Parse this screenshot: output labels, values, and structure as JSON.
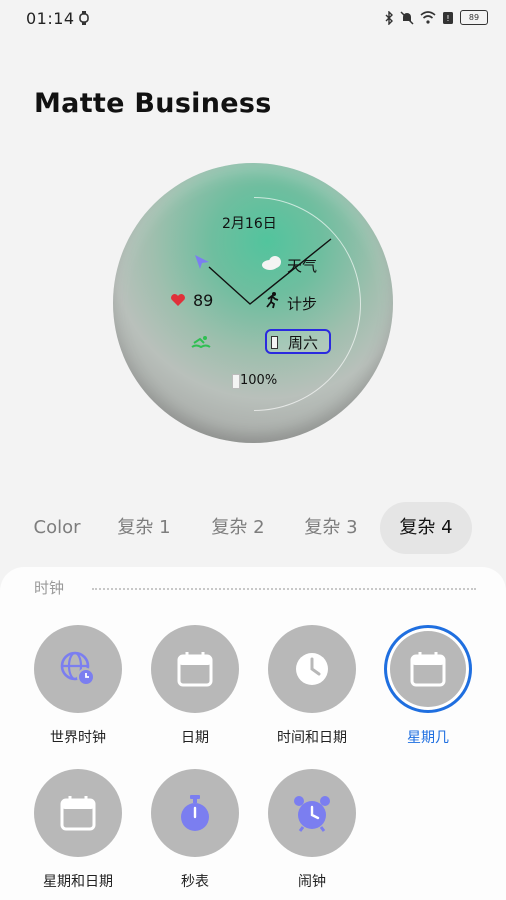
{
  "status_bar": {
    "time": "01:14",
    "battery": "89"
  },
  "title": "Matte Business",
  "watch": {
    "date": "2月16日",
    "weather": "天气",
    "steps": "计步",
    "heart_rate": "89",
    "weekday": "周六",
    "battery": "100%"
  },
  "tabs": [
    {
      "label": "Color"
    },
    {
      "label": "复杂 1"
    },
    {
      "label": "复杂 2"
    },
    {
      "label": "复杂 3"
    },
    {
      "label": "复杂 4"
    }
  ],
  "section": {
    "label": "时钟"
  },
  "options": [
    {
      "label": "世界时钟",
      "icon": "globe-clock-icon"
    },
    {
      "label": "日期",
      "icon": "calendar-icon"
    },
    {
      "label": "时间和日期",
      "icon": "clock-icon"
    },
    {
      "label": "星期几",
      "icon": "calendar-icon",
      "selected": true
    },
    {
      "label": "星期和日期",
      "icon": "calendar-icon"
    },
    {
      "label": "秒表",
      "icon": "stopwatch-icon"
    },
    {
      "label": "闹钟",
      "icon": "alarm-clock-icon"
    }
  ],
  "colors": {
    "accent": "#1f6fe0",
    "icon_purple": "#7b7ef0",
    "option_bg": "#b8b8b8"
  }
}
